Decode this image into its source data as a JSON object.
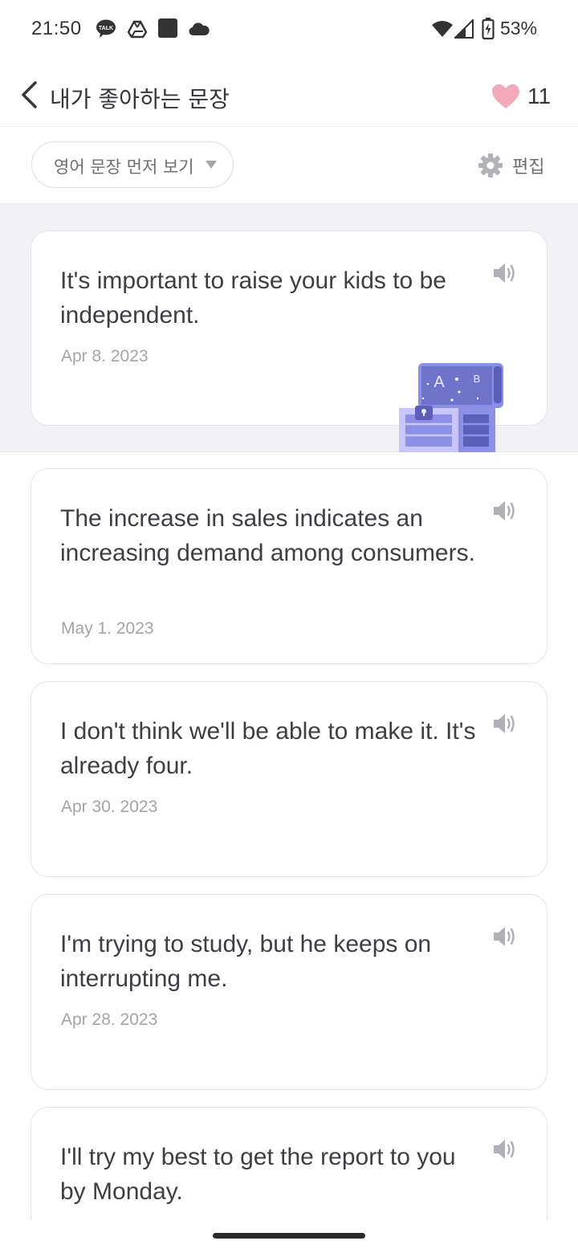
{
  "status_bar": {
    "time": "21:50",
    "battery": "53%",
    "icons": [
      "talk-icon",
      "drive-icon",
      "square-app-icon",
      "cloud-icon",
      "wifi-icon",
      "signal-icon",
      "battery-icon"
    ]
  },
  "header": {
    "title": "내가 좋아하는 문장",
    "favorite_count": "11"
  },
  "toolbar": {
    "sort_label": "영어 문장 먼저 보기",
    "edit_label": "편집"
  },
  "sentences": [
    {
      "text": "It's important to raise your kids to be independent.",
      "date": "Apr 8. 2023"
    },
    {
      "text": "The increase in sales indicates an increasing demand among consumers.",
      "date": "May 1. 2023"
    },
    {
      "text": "I don't think we'll be able to make it. It's already four.",
      "date": "Apr 30. 2023"
    },
    {
      "text": "I'm trying to study, but he keeps on interrupting me.",
      "date": "Apr 28. 2023"
    },
    {
      "text": "I'll try my best to get the report to you by Monday.",
      "date": ""
    }
  ],
  "chest_label_a": "A",
  "chest_label_b": "B",
  "colors": {
    "accent_heart": "#f2a9b9",
    "chest_purple": "#7b7fd6",
    "background_band": "#f2f2f6",
    "card_border": "#e3e3e7",
    "date_gray": "#a4a4aa"
  }
}
